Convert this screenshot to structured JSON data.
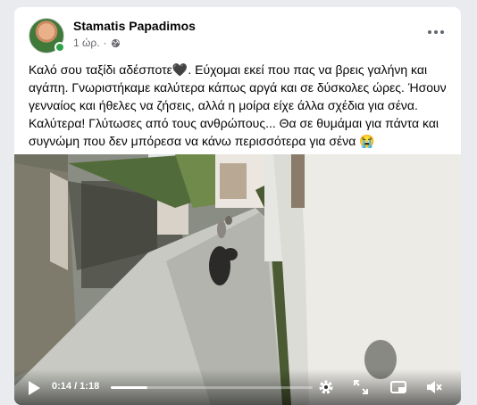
{
  "post": {
    "author": "Stamatis Papadimos",
    "time": "1 ώρ.",
    "audience_icon": "globe-icon",
    "more_icon": "more-horizontal-icon",
    "text_part1": "Καλό σου ταξίδι αδέσποτε",
    "emoji_heart": "🖤",
    "text_part2": ". Εύχομαι εκεί που πας να βρεις γαλήνη και αγάπη. Γνωριστήκαμε καλύτερα κάπως αργά και σε δύσκολες ώρες. Ήσουν γενναίος και ήθελες να ζήσεις, αλλά η μοίρα είχε άλλα σχέδια για σένα. Καλύτερα! Γλύτωσες από τους ανθρώπους... Θα σε θυμάμαι για πάντα και συγνώμη που δεν μπόρεσα να κάνω περισσότερα για σένα",
    "emoji_cry": "😭"
  },
  "video": {
    "time_display": "0:14 / 1:18",
    "progress": 0.18,
    "icons": [
      "play-icon",
      "gear-icon",
      "fullscreen-icon",
      "picture-in-picture-icon",
      "volume-muted-icon"
    ]
  },
  "colors": {
    "online": "#31a24c",
    "meta_text": "#65676b"
  }
}
